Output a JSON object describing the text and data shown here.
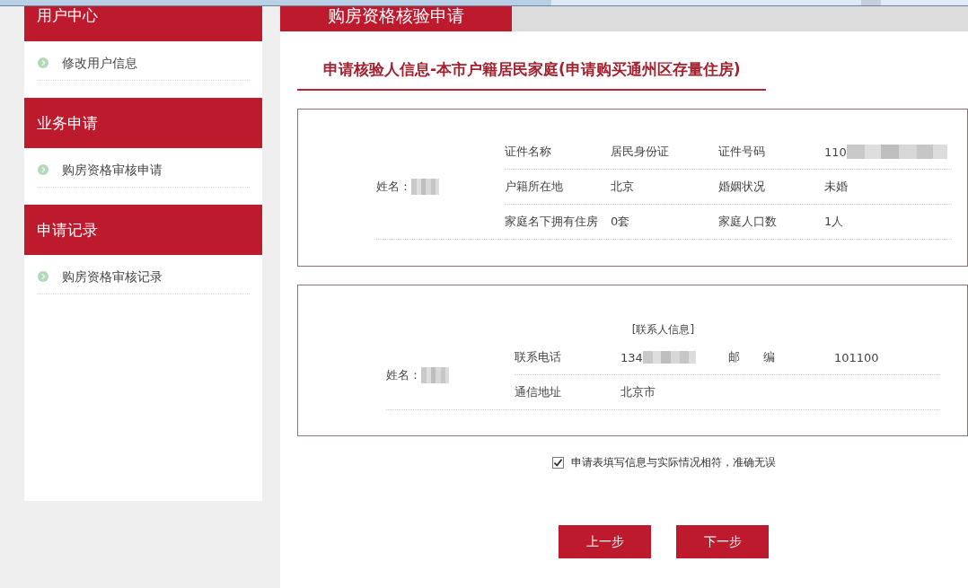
{
  "sidebar": {
    "sections": [
      {
        "title": "用户中心",
        "items": [
          {
            "label": "修改用户信息",
            "selected": false
          }
        ]
      },
      {
        "title": "业务申请",
        "items": [
          {
            "label": "购房资格审核申请",
            "selected": false
          }
        ]
      },
      {
        "title": "申请记录",
        "items": [
          {
            "label": "购房资格审核记录",
            "selected": false
          }
        ]
      }
    ]
  },
  "tabs": [
    {
      "label": "购房资格核验申请",
      "selected": true
    }
  ],
  "section_title": "申请核验人信息-本市户籍居民家庭(申请购买通州区存量住房)",
  "cards": [
    {
      "name_label": "姓名：",
      "name_redacted": true,
      "rows": [
        {
          "fields": [
            {
              "label": "证件名称",
              "value": "居民身份证"
            },
            {
              "label": "证件号码",
              "value": "110",
              "redacted": true
            }
          ]
        },
        {
          "fields": [
            {
              "label": "户籍所在地",
              "value": "北京"
            },
            {
              "label": "婚姻状况",
              "value": "未婚"
            }
          ]
        },
        {
          "fields": [
            {
              "label": "家庭名下拥有住房",
              "value": "0套"
            },
            {
              "label": "家庭人口数",
              "value": "1人"
            }
          ]
        }
      ]
    },
    {
      "heading": "[联系人信息]",
      "name_label": "姓名：",
      "name_redacted": true,
      "rows": [
        {
          "fields": [
            {
              "label": "联系电话",
              "value": "134",
              "redacted": true
            },
            {
              "label": "邮　　编",
              "value": "101100"
            }
          ]
        },
        {
          "fields": [
            {
              "label": "通信地址",
              "value": "北京市"
            }
          ]
        }
      ]
    }
  ],
  "agreement": {
    "label": "申请表填写信息与实际情况相符，准确无误",
    "checked": true
  },
  "buttons": [
    {
      "label": "上一步"
    },
    {
      "label": "下一步"
    }
  ]
}
